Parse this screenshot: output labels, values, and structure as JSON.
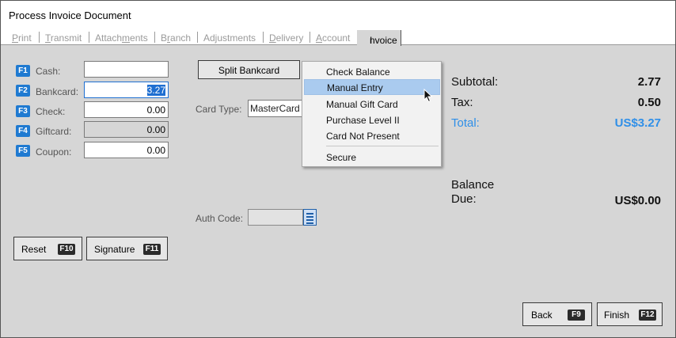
{
  "window": {
    "title": "Process Invoice Document"
  },
  "tabs": [
    {
      "pre": "",
      "u": "P",
      "post": "rint"
    },
    {
      "pre": "",
      "u": "T",
      "post": "ransmit"
    },
    {
      "pre": "Attach",
      "u": "m",
      "post": "ents"
    },
    {
      "pre": "B",
      "u": "r",
      "post": "anch"
    },
    {
      "pre": "Adjustments",
      "u": "",
      "post": ""
    },
    {
      "pre": "",
      "u": "D",
      "post": "elivery"
    },
    {
      "pre": "",
      "u": "A",
      "post": "ccount"
    },
    {
      "pre": "",
      "u": "I",
      "post": "nvoice"
    }
  ],
  "payments": [
    {
      "key": "F1",
      "label": "Cash:",
      "value": ""
    },
    {
      "key": "F2",
      "label": "Bankcard:",
      "value": "3.27"
    },
    {
      "key": "F3",
      "label": "Check:",
      "value": "0.00"
    },
    {
      "key": "F4",
      "label": "Giftcard:",
      "value": "0.00"
    },
    {
      "key": "F5",
      "label": "Coupon:",
      "value": "0.00"
    }
  ],
  "card": {
    "split_label": "Split Bankcard",
    "card_type_label": "Card Type:",
    "card_type_value": "MasterCard",
    "auth_code_label": "Auth Code:"
  },
  "menu": {
    "items": [
      "Check Balance",
      "Manual Entry",
      "Manual Gift Card",
      "Purchase Level II",
      "Card Not Present",
      "Secure"
    ],
    "highlighted": "Manual Entry"
  },
  "totals": {
    "subtotal_label": "Subtotal:",
    "subtotal_value": "2.77",
    "tax_label": "Tax:",
    "tax_value": "0.50",
    "total_label": "Total:",
    "total_value": "US$3.27",
    "balance_label_1": "Balance",
    "balance_label_2": "Due:",
    "balance_value": "US$0.00"
  },
  "buttons": {
    "reset_label": "Reset",
    "reset_key": "F10",
    "signature_label": "Signature",
    "signature_key": "F11",
    "back_label": "Back",
    "back_key": "F9",
    "finish_label": "Finish",
    "finish_key": "F12"
  },
  "colors": {
    "accent": "#1f7ad1",
    "total": "#2f8fe8",
    "highlight": "#aacbef"
  }
}
